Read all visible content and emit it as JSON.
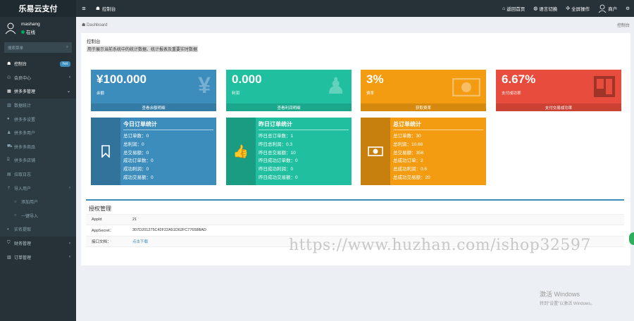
{
  "app": {
    "logo_text": "乐易云支付"
  },
  "topbar": {
    "home_label": "控制台",
    "return_home": "返回首页",
    "lang_switch": "语言切换",
    "fullscreen": "全屏操作",
    "user_label": "商户"
  },
  "sidebar": {
    "username": "mashang",
    "status": "在线",
    "search_placeholder": "搜索菜单",
    "items": [
      {
        "label": "控制台",
        "icon": "dashboard-icon",
        "badge": "hot"
      },
      {
        "label": "会员中心",
        "icon": "users-icon"
      },
      {
        "label": "拼多多管理",
        "icon": "grid-icon"
      },
      {
        "label": "数据统计",
        "icon": "chart-icon"
      },
      {
        "label": "拼多多设置",
        "icon": "gear-icon"
      },
      {
        "label": "拼多多用户",
        "icon": "user-icon"
      },
      {
        "label": "拼多多商品",
        "icon": "cart-icon"
      },
      {
        "label": "拼多多店铺",
        "icon": "store-icon"
      },
      {
        "label": "拉取日志",
        "icon": "log-icon"
      },
      {
        "label": "导入用户",
        "icon": "import-icon"
      },
      {
        "label": "添加用户",
        "icon": "circle-icon"
      },
      {
        "label": "一键导入",
        "icon": "circle-icon"
      },
      {
        "label": "实名提取",
        "icon": "id-icon"
      },
      {
        "label": "财务管理",
        "icon": "finance-icon"
      },
      {
        "label": "订单管理",
        "icon": "order-icon"
      }
    ]
  },
  "breadcrumb": {
    "current": "Dashboard",
    "right": "控制台"
  },
  "page": {
    "title": "控制台",
    "subtitle": "用于展示当前系统中的统计数据、统计报表及重要实时数据"
  },
  "stats": [
    {
      "value": "¥100.000",
      "label": "余额",
      "footer": "查看余额明细",
      "color": "#3c8dbc",
      "icon": "yen-icon"
    },
    {
      "value": "0.000",
      "label": "利润",
      "footer": "查看利润明细",
      "color": "#1fbf9f",
      "icon": "person-pin-icon"
    },
    {
      "value": "3%",
      "label": "费率",
      "footer": "获取费率",
      "color": "#f39c12",
      "icon": "money-icon"
    },
    {
      "value": "6.67%",
      "label": "支付成功率",
      "footer": "支付交易成功率",
      "color": "#e74c3c",
      "icon": "window-icon"
    }
  ],
  "order_boxes": [
    {
      "title": "今日订单统计",
      "icon": "bookmark-icon",
      "color": "#3c8dbc",
      "rows": [
        "总订单数：0",
        "总利润：0",
        "总交易额：0",
        "成功订单数：0",
        "成功利润：0",
        "成功交易额：0"
      ]
    },
    {
      "title": "昨日订单统计",
      "icon": "thumbs-up-icon",
      "color": "#1fbf9f",
      "rows": [
        "昨日总订单数：1",
        "昨日总利润：0.3",
        "昨日总交易额：10",
        "昨日成功订单数：0",
        "昨日成功利润：0",
        "昨日成功交易额：0"
      ]
    },
    {
      "title": "总订单统计",
      "icon": "money-icon",
      "color": "#f39c12",
      "rows": [
        "总订单数：30",
        "总利润：10.68",
        "总交易额：356",
        "总成功订单：2",
        "总成功利润：0.6",
        "总成功交易额：20"
      ]
    }
  ],
  "auth": {
    "title": "授权管理",
    "rows": [
      {
        "key": "AppId",
        "value": "21"
      },
      {
        "key": "AppSecret：",
        "value": "307D201275C42F22A51D62FC77658BAD"
      },
      {
        "key": "接口文档：",
        "value": "点击下载"
      }
    ]
  },
  "watermark": "https://www.huzhan.com/ishop32597",
  "windows_activation": {
    "line1": "激活 Windows",
    "line2": "转到\"设置\"以激活 Windows。"
  }
}
